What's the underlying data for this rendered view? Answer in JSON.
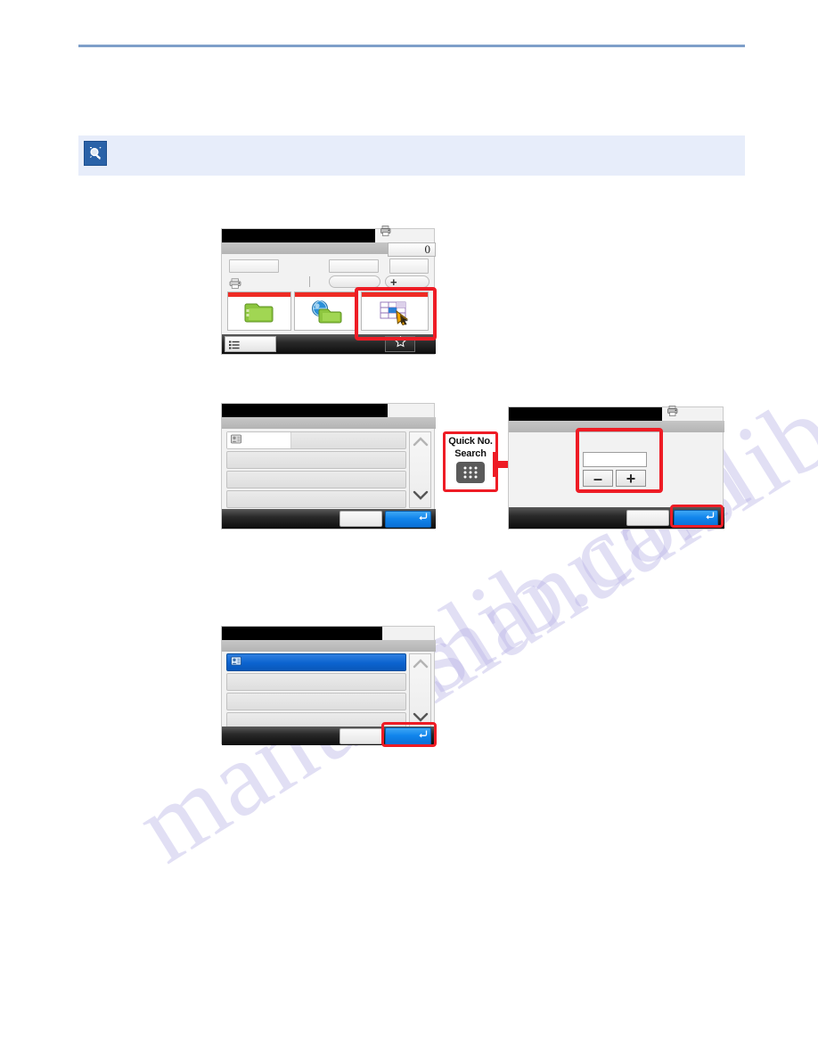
{
  "page": {
    "watermark": "manualslib.com"
  },
  "note": {
    "icon": "note-magnifier-icon",
    "text": ""
  },
  "panel1": {
    "name": "send-destination-screen",
    "title": "",
    "counter_value": "0",
    "status_icon": "printer-status-icon",
    "fields": {
      "field1": "",
      "field2": "",
      "field3": ""
    },
    "toolbar": {
      "printer_icon": "printer-icon",
      "pill_label": "",
      "add_label": "+"
    },
    "tabs": [
      {
        "name": "address-book-tab",
        "icon": "green-folder-icon",
        "label": ""
      },
      {
        "name": "ext-address-book-tab",
        "icon": "globe-folder-icon",
        "label": ""
      },
      {
        "name": "address-book-select-tab",
        "icon": "grid-pointer-icon",
        "label": ""
      }
    ],
    "bottom": {
      "menu_icon": "list-menu-icon",
      "menu_label": "",
      "favorites_icon": "star-icon"
    },
    "highlight": "address-book-select-tab"
  },
  "panel2": {
    "name": "address-book-list-screen",
    "title": "",
    "rows": [
      {
        "icon": "contact-icon",
        "label": "",
        "selected": false,
        "has_white_segment": true
      },
      {
        "icon": "",
        "label": "",
        "selected": false,
        "has_white_segment": false
      },
      {
        "icon": "",
        "label": "",
        "selected": false,
        "has_white_segment": false
      },
      {
        "icon": "",
        "label": "",
        "selected": false,
        "has_white_segment": false
      }
    ],
    "scroll": {
      "up_icon": "chevron-up-icon",
      "down_icon": "chevron-down-icon"
    },
    "buttons": {
      "cancel_label": "",
      "ok_label": "",
      "ok_icon": "enter-arrow-icon"
    }
  },
  "badge": {
    "name": "quick-no-search-badge",
    "line1": "Quick No.",
    "line2": "Search",
    "key_icon": "numeric-keypad-icon",
    "arrow_icon": "red-arrow-right-icon"
  },
  "panel3": {
    "name": "quick-no-entry-screen",
    "title": "",
    "counter_value": "",
    "status_icon": "printer-status-icon",
    "number_value": "",
    "minus_label": "–",
    "plus_label": "+",
    "buttons": {
      "cancel_label": "",
      "ok_label": "",
      "ok_icon": "enter-arrow-icon"
    },
    "highlights": [
      "number-entry-group",
      "ok-button"
    ]
  },
  "panel4": {
    "name": "address-book-selected-screen",
    "title": "",
    "rows": [
      {
        "icon": "contact-icon",
        "label": "",
        "selected": true,
        "has_white_segment": false
      },
      {
        "icon": "",
        "label": "",
        "selected": false,
        "has_white_segment": false
      },
      {
        "icon": "",
        "label": "",
        "selected": false,
        "has_white_segment": false
      },
      {
        "icon": "",
        "label": "",
        "selected": false,
        "has_white_segment": false
      }
    ],
    "scroll": {
      "up_icon": "chevron-up-icon",
      "down_icon": "chevron-down-icon"
    },
    "buttons": {
      "cancel_label": "",
      "ok_label": "",
      "ok_icon": "enter-arrow-icon"
    },
    "highlight": "ok-button"
  },
  "colors": {
    "rule": "#7e9fc9",
    "note_bg": "#e7edfa",
    "note_icon_bg": "#2a62a8",
    "annotation_red": "#ee1c25",
    "ok_blue": "#1185ec",
    "tab_accent": "#ef2b24",
    "watermark": "#b9b4e6"
  }
}
